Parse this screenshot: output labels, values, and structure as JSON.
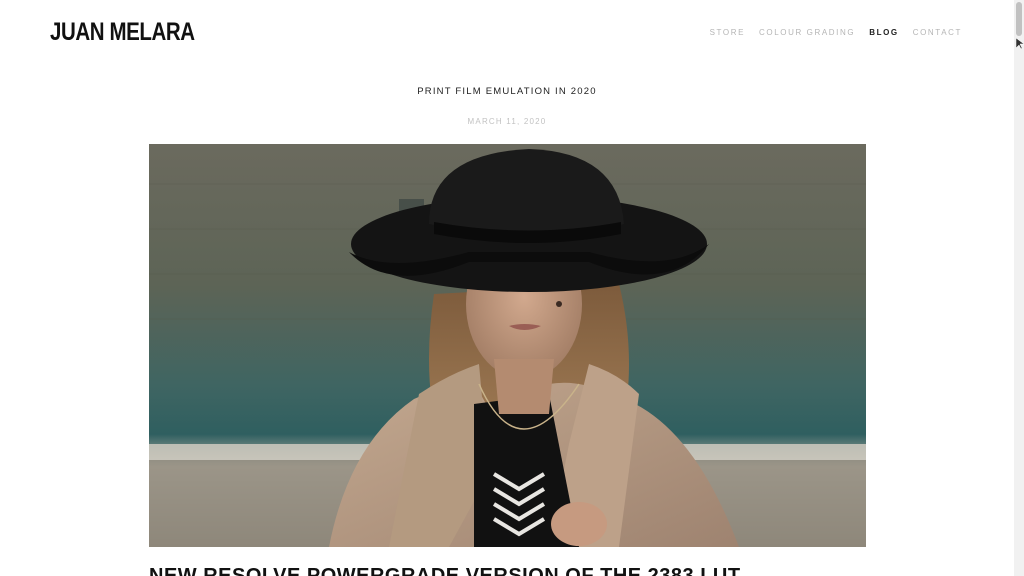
{
  "site": {
    "logo": "JUAN MELARA"
  },
  "nav": {
    "items": [
      {
        "label": "STORE",
        "active": false
      },
      {
        "label": "COLOUR GRADING",
        "active": false
      },
      {
        "label": "BLOG",
        "active": true
      },
      {
        "label": "CONTACT",
        "active": false
      }
    ]
  },
  "post": {
    "title": "PRINT FILM EMULATION IN 2020",
    "date": "MARCH 11, 2020",
    "image_alt": "Woman in black wide-brimmed hat and camel coat"
  },
  "next_post": {
    "title": "NEW RESOLVE POWERGRADE VERSION OF THE 2383 LUT"
  },
  "colors": {
    "nav_inactive": "#b5b5b5",
    "nav_active": "#222222",
    "date": "#c2c2c2"
  }
}
